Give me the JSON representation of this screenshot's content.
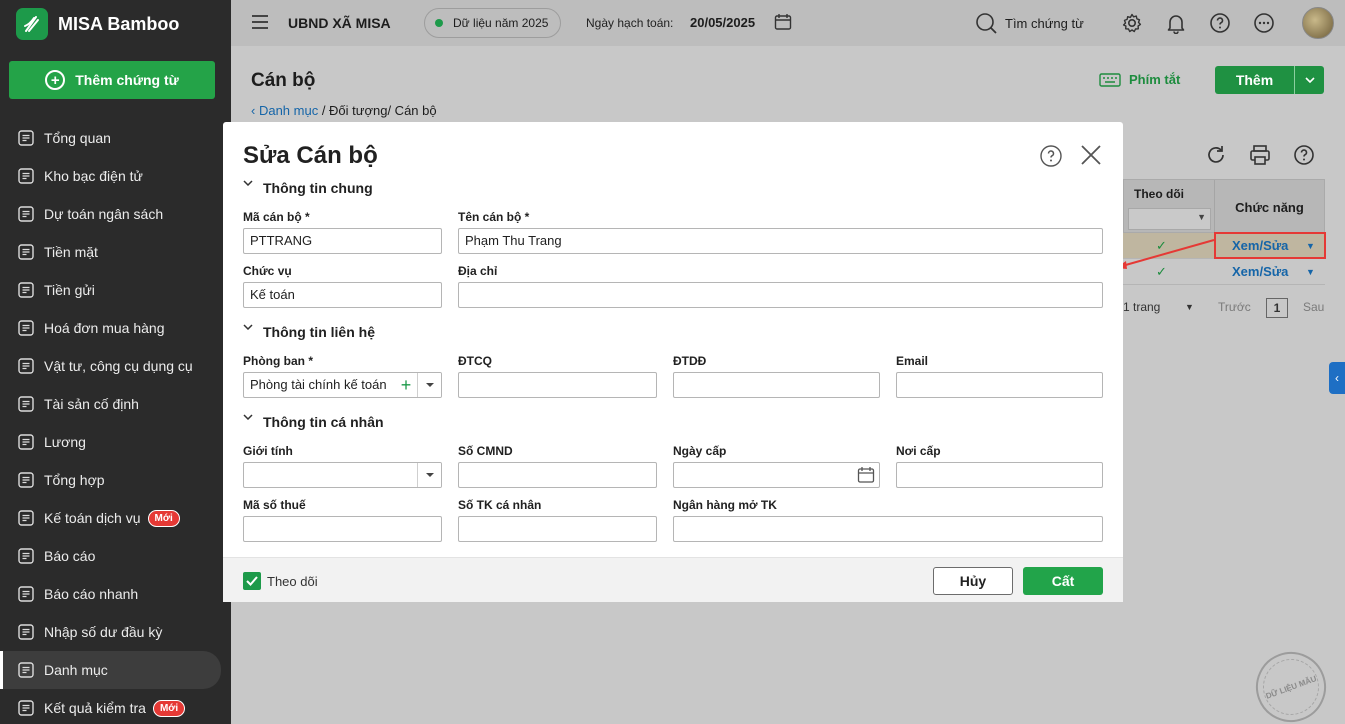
{
  "app": {
    "name": "MISA Bamboo",
    "add_doc_label": "Thêm chứng từ"
  },
  "sidebar": {
    "items": [
      {
        "label": "Tổng quan",
        "icon": "pie-chart-icon"
      },
      {
        "label": "Kho bạc điện tử",
        "icon": "monitor-icon"
      },
      {
        "label": "Dự toán ngân sách",
        "icon": "budget-icon"
      },
      {
        "label": "Tiền mặt",
        "icon": "cash-icon"
      },
      {
        "label": "Tiền gửi",
        "icon": "deposit-icon"
      },
      {
        "label": "Hoá đơn mua hàng",
        "icon": "invoice-icon"
      },
      {
        "label": "Vật tư, công cụ dụng cụ",
        "icon": "tools-icon"
      },
      {
        "label": "Tài sản cố định",
        "icon": "building-icon"
      },
      {
        "label": "Lương",
        "icon": "salary-icon"
      },
      {
        "label": "Tổng hợp",
        "icon": "summary-icon"
      },
      {
        "label": "Kế toán dịch vụ",
        "icon": "service-icon",
        "badge": "Mới"
      },
      {
        "label": "Báo cáo",
        "icon": "report-icon"
      },
      {
        "label": "Báo cáo nhanh",
        "icon": "quick-report-icon"
      },
      {
        "label": "Nhập số dư đầu kỳ",
        "icon": "opening-balance-icon"
      },
      {
        "label": "Danh mục",
        "icon": "catalog-icon",
        "active": true
      },
      {
        "label": "Kết quả kiểm tra",
        "icon": "check-result-icon",
        "badge": "Mới"
      }
    ]
  },
  "header": {
    "org": "UBND XÃ MISA",
    "data_year": "Dữ liệu năm 2025",
    "posting_date_label": "Ngày hạch toán:",
    "posting_date": "20/05/2025",
    "search_placeholder": "Tìm chứng từ"
  },
  "page": {
    "title": "Cán bộ",
    "breadcrumb_link": "Danh mục",
    "breadcrumb_rest": " / Đối tượng/ Cán bộ",
    "shortcut_label": "Phím tắt",
    "add_label": "Thêm"
  },
  "grid": {
    "col_follow": "Theo dõi",
    "col_function": "Chức năng",
    "rows": [
      {
        "follow": "✓",
        "action": "Xem/Sửa"
      },
      {
        "follow": "✓",
        "action": "Xem/Sửa"
      }
    ],
    "pager": {
      "total_pages": "1 trang",
      "prev": "Trước",
      "page": "1",
      "next": "Sau"
    }
  },
  "watermark": "DỮ LIỆU MẪU",
  "dialog": {
    "title": "Sửa Cán bộ",
    "sections": {
      "general": "Thông tin chung",
      "contact": "Thông tin liên hệ",
      "personal": "Thông tin cá nhân"
    },
    "fields": {
      "code": {
        "label": "Mã cán bộ *",
        "value": "PTTRANG"
      },
      "name": {
        "label": "Tên cán bộ *",
        "value": "Phạm Thu Trang"
      },
      "position": {
        "label": "Chức vụ",
        "value": "Kế toán"
      },
      "address": {
        "label": "Địa chỉ",
        "value": ""
      },
      "department": {
        "label": "Phòng ban *",
        "value": "Phòng tài chính kế toán"
      },
      "office_phone": {
        "label": "ĐTCQ",
        "value": ""
      },
      "mobile": {
        "label": "ĐTDĐ",
        "value": ""
      },
      "email": {
        "label": "Email",
        "value": ""
      },
      "gender": {
        "label": "Giới tính",
        "value": ""
      },
      "id_number": {
        "label": "Số CMND",
        "value": ""
      },
      "issue_date": {
        "label": "Ngày cấp",
        "value": ""
      },
      "issue_place": {
        "label": "Nơi cấp",
        "value": ""
      },
      "tax_code": {
        "label": "Mã số thuế",
        "value": ""
      },
      "bank_account": {
        "label": "Số TK cá nhân",
        "value": ""
      },
      "bank_name": {
        "label": "Ngân hàng mở TK",
        "value": ""
      }
    },
    "follow_label": "Theo dõi",
    "cancel_label": "Hủy",
    "save_label": "Cất"
  },
  "colors": {
    "brand_green": "#24a348",
    "link_blue": "#1565a8",
    "highlight_red": "#e53935"
  }
}
